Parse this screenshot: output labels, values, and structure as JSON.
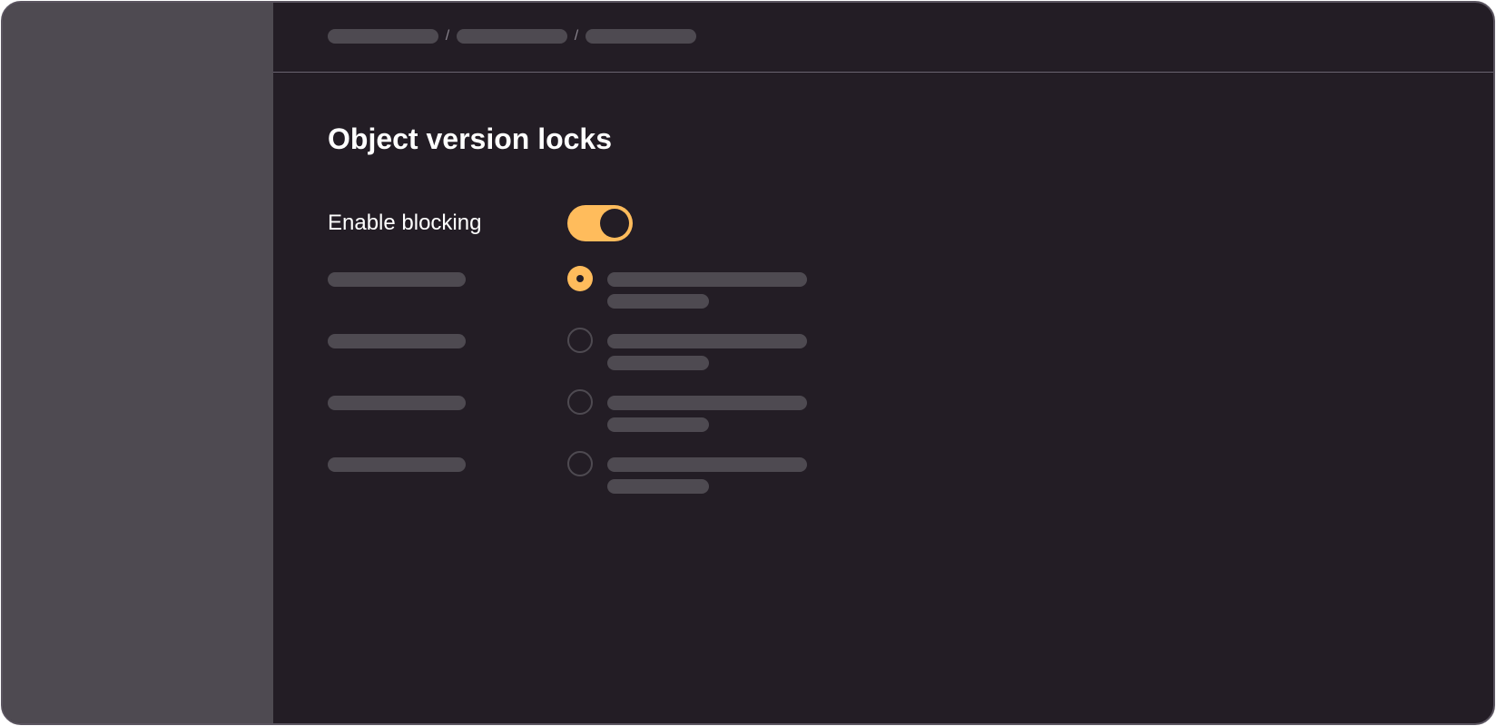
{
  "page": {
    "title": "Object version locks"
  },
  "breadcrumb": {
    "separator": "/"
  },
  "settings": {
    "enable_blocking_label": "Enable blocking",
    "enable_blocking_on": true
  },
  "options": [
    {
      "selected": true
    },
    {
      "selected": false
    },
    {
      "selected": false
    },
    {
      "selected": false
    }
  ],
  "colors": {
    "accent": "#ffbc5c",
    "background": "#231d25",
    "sidebar": "#4e4a51",
    "placeholder": "#4e4a51",
    "text": "#ffffff"
  }
}
